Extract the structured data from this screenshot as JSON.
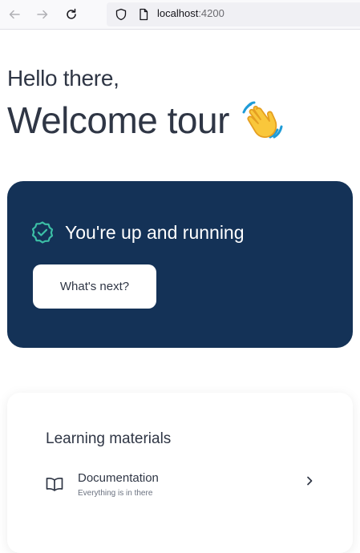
{
  "browser": {
    "url_host": "localhost",
    "url_port": ":4200",
    "icons": {
      "back": "back-arrow-icon",
      "forward": "forward-arrow-icon",
      "reload": "reload-icon",
      "shield": "shield-icon",
      "page": "page-icon"
    }
  },
  "main": {
    "greeting": "Hello there,",
    "heading": "Welcome tour",
    "heading_emoji": "waving-hand-icon"
  },
  "hero": {
    "title": "You're up and running",
    "button_label": "What's next?",
    "background": "#143257",
    "accent": "#3cbfa6"
  },
  "learning": {
    "title": "Learning materials",
    "items": [
      {
        "label": "Documentation",
        "description": "Everything is in there",
        "icon": "book-icon"
      }
    ]
  }
}
